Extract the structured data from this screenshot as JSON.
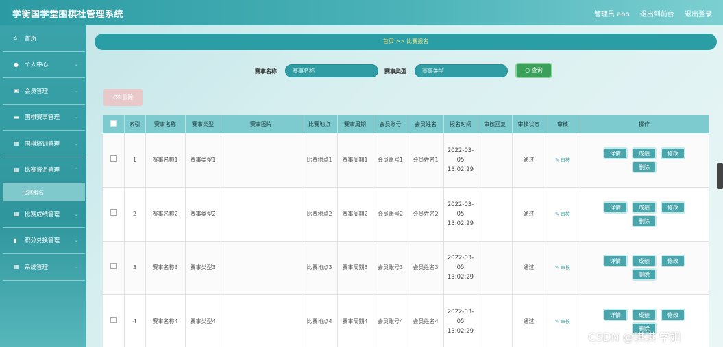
{
  "header": {
    "app_title": "学衡国学堂围棋社管理系统",
    "admin_label": "管理员 abo",
    "exit_front": "退出到前台",
    "logout": "退出登录"
  },
  "sidebar": {
    "items": [
      {
        "icon": "home-icon",
        "label": "首页"
      },
      {
        "icon": "user-icon",
        "label": "个人中心"
      },
      {
        "icon": "doc-icon",
        "label": "会员管理"
      },
      {
        "icon": "monitor-icon",
        "label": "围棋赛事管理"
      },
      {
        "icon": "grid-icon",
        "label": "围棋培训管理"
      },
      {
        "icon": "grid-icon",
        "label": "比赛报名管理"
      },
      {
        "icon": "grid-icon",
        "label": "比赛成绩管理"
      },
      {
        "icon": "chart-icon",
        "label": "积分兑换管理"
      },
      {
        "icon": "grid-icon",
        "label": "系统管理"
      }
    ],
    "active_submenu": "比赛报名"
  },
  "breadcrumb": {
    "text": "首页 >> 比赛报名"
  },
  "search": {
    "name_label": "赛事名称",
    "name_placeholder": "赛事名称",
    "type_label": "赛事类型",
    "type_placeholder": "赛事类型",
    "query_button": "查询"
  },
  "toolbar": {
    "delete_label": "删除"
  },
  "table": {
    "headers": [
      "索引",
      "赛事名称",
      "赛事类型",
      "赛事图片",
      "比赛地点",
      "赛事周期",
      "会员账号",
      "会员姓名",
      "报名时间",
      "审核回复",
      "审核状态",
      "审核",
      "操作"
    ],
    "audit_link": "审核",
    "buttons": {
      "detail": "详情",
      "score": "成绩",
      "edit": "修改",
      "delete": "删除"
    },
    "rows": [
      {
        "index": "1",
        "name": "赛事名称1",
        "type": "赛事类型1",
        "location": "比赛地点1",
        "period": "赛事周期1",
        "account": "会员账号1",
        "member_name": "会员姓名1",
        "time": "2022-03-05 13:02:29",
        "reply": "",
        "status": "通过"
      },
      {
        "index": "2",
        "name": "赛事名称2",
        "type": "赛事类型2",
        "location": "比赛地点2",
        "period": "赛事周期2",
        "account": "会员账号2",
        "member_name": "会员姓名2",
        "time": "2022-03-05 13:02:29",
        "reply": "",
        "status": "通过"
      },
      {
        "index": "3",
        "name": "赛事名称3",
        "type": "赛事类型3",
        "location": "比赛地点3",
        "period": "赛事周期3",
        "account": "会员账号3",
        "member_name": "会员姓名3",
        "time": "2022-03-05 13:02:29",
        "reply": "",
        "status": "通过"
      },
      {
        "index": "4",
        "name": "赛事名称4",
        "type": "赛事类型4",
        "location": "比赛地点4",
        "period": "赛事周期4",
        "account": "会员账号4",
        "member_name": "会员姓名4",
        "time": "2022-03-05 13:02:29",
        "reply": "",
        "status": "通过"
      }
    ]
  },
  "watermark": "CSDN @琪琪 学姐"
}
